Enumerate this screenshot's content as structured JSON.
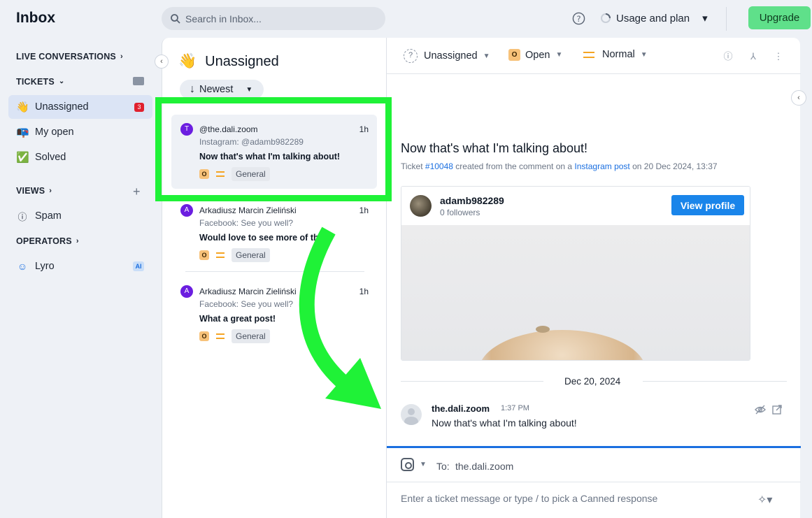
{
  "header": {
    "title": "Inbox",
    "search_placeholder": "Search in Inbox...",
    "usage_label": "Usage and plan",
    "upgrade_label": "Upgrade"
  },
  "sidebar": {
    "live_conversations": "LIVE CONVERSATIONS",
    "tickets": "TICKETS",
    "items": [
      {
        "label": "Unassigned",
        "icon": "waving-hand-icon",
        "badge": "3"
      },
      {
        "label": "My open",
        "icon": "mailbox-icon"
      },
      {
        "label": "Solved",
        "icon": "check-mark-icon"
      }
    ],
    "views": "VIEWS",
    "spam": "Spam",
    "operators": "OPERATORS",
    "lyro": "Lyro",
    "lyro_badge": "AI"
  },
  "list": {
    "title": "Unassigned",
    "sort_label": "Newest",
    "tickets": [
      {
        "avatar": "T",
        "author": "@the.dali.zoom",
        "time": "1h",
        "source": "Instagram: @adamb982289",
        "message": "Now that's what I'm talking about!",
        "status": "O",
        "tag": "General"
      },
      {
        "avatar": "A",
        "author": "Arkadiusz Marcin Zieliński",
        "time": "1h",
        "source": "Facebook: See you well?",
        "message": "Would love to see more of this",
        "status": "O",
        "tag": "General"
      },
      {
        "avatar": "A",
        "author": "Arkadiusz Marcin Zieliński",
        "time": "1h",
        "source": "Facebook: See you well?",
        "message": "What a great post!",
        "status": "O",
        "tag": "General"
      }
    ]
  },
  "detail": {
    "assignee": "Unassigned",
    "status_chip": "O",
    "status": "Open",
    "priority": "Normal",
    "title": "Now that's what I'm talking about!",
    "sub_prefix": "Ticket",
    "ticket_id": "#10048",
    "sub_mid": "created from the comment on a",
    "sub_link": "Instagram post",
    "sub_suffix": "on 20 Dec 2024, 13:37",
    "profile": {
      "name": "adamb982289",
      "followers": "0 followers",
      "button": "View profile"
    },
    "date_divider": "Dec 20, 2024",
    "message": {
      "author": "the.dali.zoom",
      "time": "1:37 PM",
      "text": "Now that's what I'm talking about!"
    },
    "composer": {
      "to_label": "To:",
      "to_value": "the.dali.zoom",
      "placeholder": "Enter a ticket message or type / to pick a Canned response"
    }
  },
  "colors": {
    "accent": "#1b6fe0",
    "upgrade": "#5fe08a",
    "highlight": "#1ff237",
    "badge": "#e0202e"
  }
}
